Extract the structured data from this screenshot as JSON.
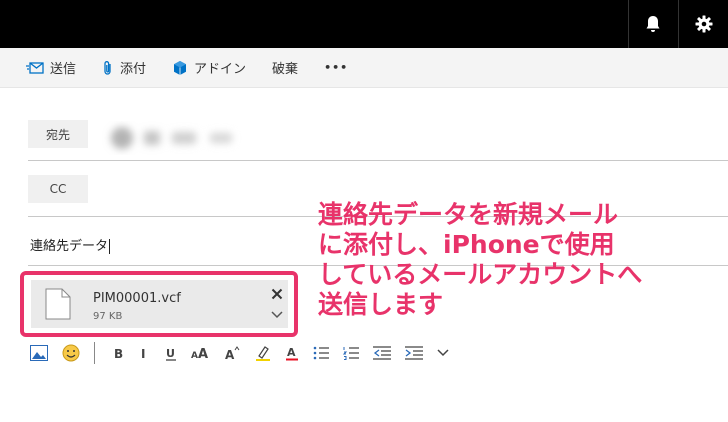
{
  "toolbar": {
    "send": "送信",
    "attach": "添付",
    "addin": "アドイン",
    "discard": "破棄",
    "more": "•••"
  },
  "fields": {
    "to_label": "宛先",
    "cc_label": "CC",
    "subject": "連絡先データ"
  },
  "attachment": {
    "file_name": "PIM00001.vcf",
    "file_size": "97 KB"
  },
  "annotation": {
    "lines": [
      "連絡先データを新規メール",
      "に添付し、iPhoneで使用",
      "しているメールアカウントへ",
      "送信します"
    ]
  },
  "colors": {
    "accent": "#0072c6",
    "highlight": "#e8336a"
  }
}
